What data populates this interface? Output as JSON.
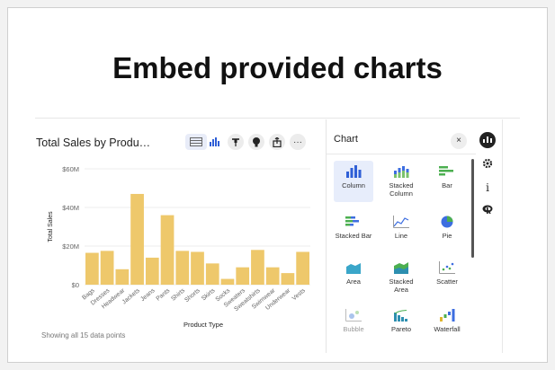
{
  "slide": {
    "headline": "Embed provided charts"
  },
  "chart": {
    "title": "Total Sales by Produ…",
    "footer": "Showing all 15 data points",
    "toolbar_icons": [
      "table-icon",
      "column-chart-icon",
      "pin-icon",
      "idea-icon",
      "share-icon",
      "more-icon"
    ],
    "more_label": "···"
  },
  "chart_data": {
    "type": "bar",
    "title": "Total Sales by Produ…",
    "xlabel": "Product Type",
    "ylabel": "Total Sales",
    "ylim": [
      0,
      60
    ],
    "yticks": [
      "$0",
      "$20M",
      "$40M",
      "$60M"
    ],
    "categories": [
      "Bags",
      "Dresses",
      "Headwear",
      "Jackets",
      "Jeans",
      "Pants",
      "Shirts",
      "Shorts",
      "Skirts",
      "Socks",
      "Sweaters",
      "Sweatshirts",
      "Swimwear",
      "Underwear",
      "Vests"
    ],
    "values": [
      16.5,
      17.5,
      8,
      47,
      14,
      36,
      17.5,
      17,
      11,
      3,
      9,
      18,
      9,
      6,
      17
    ],
    "color": "#eec86b",
    "grid": true
  },
  "panel": {
    "title": "Chart",
    "close": "×",
    "types": [
      {
        "label": "Column",
        "icon": "column-chart-icon",
        "selected": true
      },
      {
        "label": "Stacked Column",
        "icon": "stacked-column-icon"
      },
      {
        "label": "Bar",
        "icon": "bar-chart-icon"
      },
      {
        "label": "Stacked Bar",
        "icon": "stacked-bar-icon"
      },
      {
        "label": "Line",
        "icon": "line-chart-icon"
      },
      {
        "label": "Pie",
        "icon": "pie-chart-icon"
      },
      {
        "label": "Area",
        "icon": "area-chart-icon"
      },
      {
        "label": "Stacked Area",
        "icon": "stacked-area-icon"
      },
      {
        "label": "Scatter",
        "icon": "scatter-chart-icon"
      },
      {
        "label": "Bubble",
        "icon": "bubble-chart-icon",
        "disabled": true
      },
      {
        "label": "Pareto",
        "icon": "pareto-chart-icon"
      },
      {
        "label": "Waterfall",
        "icon": "waterfall-chart-icon"
      }
    ]
  },
  "side": {
    "icons": [
      "chart-type-icon",
      "settings-icon",
      "info-icon",
      "r-analysis-icon"
    ],
    "info_glyph": "i"
  }
}
